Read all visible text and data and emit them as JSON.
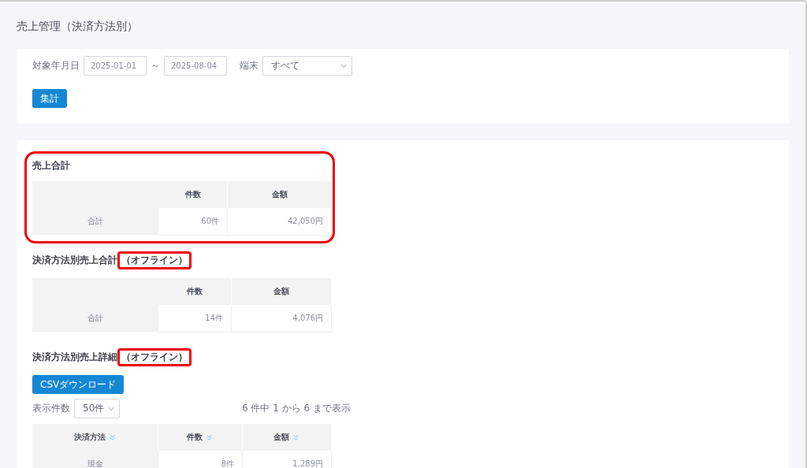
{
  "page": {
    "title": "売上管理（決済方法別）"
  },
  "filters": {
    "date_label": "対象年月日",
    "date_from": "2025-01-01",
    "separator": "～",
    "date_to": "2025-08-04",
    "terminal_label": "端末",
    "terminal_value": "すべて",
    "submit": "集計"
  },
  "sections": [
    {
      "kind": "summary",
      "title": "売上合計",
      "highlighted": true,
      "columns": [
        {
          "label": "件数"
        },
        {
          "label": "金額"
        }
      ],
      "rows": [
        {
          "cells": [
            "合計",
            "60件",
            "42,050円"
          ]
        }
      ]
    },
    {
      "kind": "summary",
      "title": "決済方法別売上合計",
      "note": "（オフライン）",
      "highlighted": false,
      "note_highlighted": true,
      "columns": [
        {
          "label": "件数"
        },
        {
          "label": "金額"
        }
      ],
      "rows": [
        {
          "cells": [
            "合計",
            "14件",
            "4,076円"
          ]
        }
      ]
    },
    {
      "kind": "detail",
      "title": "決済方法別売上詳細",
      "note": "（オフライン）",
      "highlighted": false,
      "note_highlighted": true,
      "csv_button": "CSVダウンロード",
      "page_size_label": "表示件数",
      "page_size": "50件",
      "info": "6 件中 1 から 6 まで表示",
      "columns": [
        {
          "label": "決済方法",
          "sortable": true
        },
        {
          "label": "件数",
          "sortable": true
        },
        {
          "label": "金額",
          "sortable": true
        }
      ],
      "rows": [
        {
          "cells": [
            "現金",
            "8件",
            "1,289円"
          ]
        }
      ]
    }
  ]
}
